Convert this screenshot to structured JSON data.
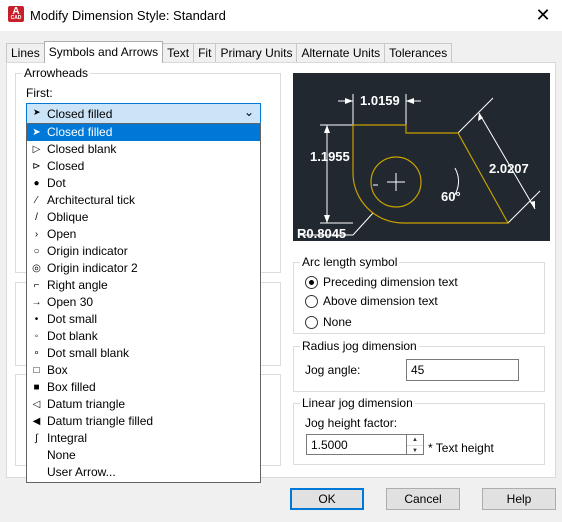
{
  "window": {
    "title": "Modify Dimension Style: Standard",
    "close_glyph": "✕"
  },
  "tabs": [
    {
      "label": "Lines"
    },
    {
      "label": "Symbols and Arrows",
      "active": true
    },
    {
      "label": "Text"
    },
    {
      "label": "Fit"
    },
    {
      "label": "Primary Units"
    },
    {
      "label": "Alternate Units"
    },
    {
      "label": "Tolerances"
    }
  ],
  "arrowheads": {
    "group_label": "Arrowheads",
    "first_label": "First:",
    "first_value": "Closed filled",
    "options": [
      {
        "label": "Closed filled",
        "icon": "closed-filled-arrow-icon",
        "glyph": "➤",
        "selected": true
      },
      {
        "label": "Closed blank",
        "icon": "closed-blank-arrow-icon",
        "glyph": "▷"
      },
      {
        "label": "Closed",
        "icon": "closed-arrow-icon",
        "glyph": "⊳"
      },
      {
        "label": "Dot",
        "icon": "dot-arrow-icon",
        "glyph": "●"
      },
      {
        "label": "Architectural tick",
        "icon": "architectural-tick-icon",
        "glyph": "⁄"
      },
      {
        "label": "Oblique",
        "icon": "oblique-icon",
        "glyph": "/"
      },
      {
        "label": "Open",
        "icon": "open-arrow-icon",
        "glyph": "›"
      },
      {
        "label": "Origin indicator",
        "icon": "origin-indicator-icon",
        "glyph": "○"
      },
      {
        "label": "Origin indicator 2",
        "icon": "origin-indicator-2-icon",
        "glyph": "◎"
      },
      {
        "label": "Right angle",
        "icon": "right-angle-icon",
        "glyph": "⌐"
      },
      {
        "label": "Open 30",
        "icon": "open-30-icon",
        "glyph": "→"
      },
      {
        "label": "Dot small",
        "icon": "dot-small-icon",
        "glyph": "•"
      },
      {
        "label": "Dot blank",
        "icon": "dot-blank-icon",
        "glyph": "◦"
      },
      {
        "label": "Dot small blank",
        "icon": "dot-small-blank-icon",
        "glyph": "∘"
      },
      {
        "label": "Box",
        "icon": "box-icon",
        "glyph": "□"
      },
      {
        "label": "Box filled",
        "icon": "box-filled-icon",
        "glyph": "■"
      },
      {
        "label": "Datum triangle",
        "icon": "datum-triangle-icon",
        "glyph": "◁"
      },
      {
        "label": "Datum triangle filled",
        "icon": "datum-triangle-filled-icon",
        "glyph": "◀"
      },
      {
        "label": "Integral",
        "icon": "integral-icon",
        "glyph": "∫"
      },
      {
        "label": "None",
        "icon": "",
        "glyph": ""
      },
      {
        "label": "User Arrow...",
        "icon": "",
        "glyph": ""
      }
    ]
  },
  "preview": {
    "dim_top": "1.0159",
    "dim_left": "1.1955",
    "dim_right": "2.0207",
    "dim_angle": "60°",
    "dim_radius": "R0.8045"
  },
  "arc_length": {
    "group_label": "Arc length symbol",
    "options": [
      {
        "label": "Preceding dimension text",
        "checked": true
      },
      {
        "label": "Above dimension text",
        "checked": false
      },
      {
        "label": "None",
        "checked": false
      }
    ]
  },
  "radius_jog": {
    "group_label": "Radius jog dimension",
    "jog_angle_label": "Jog angle:",
    "jog_angle_value": "45"
  },
  "linear_jog": {
    "group_label": "Linear jog dimension",
    "height_label": "Jog height factor:",
    "height_value": "1.5000",
    "suffix": "* Text height"
  },
  "buttons": {
    "ok": "OK",
    "cancel": "Cancel",
    "help": "Help"
  },
  "colors": {
    "accent": "#0078d7",
    "preview_bg": "#212830",
    "preview_geometry": "#c8a000"
  }
}
